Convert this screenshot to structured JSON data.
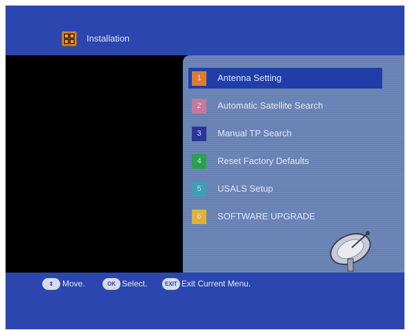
{
  "header": {
    "title": "Installation",
    "icon": "installation-icon"
  },
  "menu": {
    "items": [
      {
        "number": "1",
        "label": "Antenna Setting",
        "color": "#e07a2c",
        "selected": true
      },
      {
        "number": "2",
        "label": "Automatic Satellite Search",
        "color": "#c9789b",
        "selected": false
      },
      {
        "number": "3",
        "label": "Manual TP Search",
        "color": "#2a3795",
        "selected": false
      },
      {
        "number": "4",
        "label": "Reset Factory Defaults",
        "color": "#2aa14a",
        "selected": false
      },
      {
        "number": "5",
        "label": "USALS Setup",
        "color": "#3b9fb5",
        "selected": false
      },
      {
        "number": "6",
        "label": "SOFTWARE UPGRADE",
        "color": "#e0b23c",
        "selected": false
      }
    ]
  },
  "footer": {
    "move_key": "⇕",
    "move_label": "Move.",
    "ok_key": "OK",
    "select_label": "Select.",
    "exit_key": "EXIT",
    "exit_label": "Exit Current Menu."
  },
  "colors": {
    "background": "#2a44a8",
    "panel": "#6c86b8",
    "highlight": "#213ea8"
  }
}
